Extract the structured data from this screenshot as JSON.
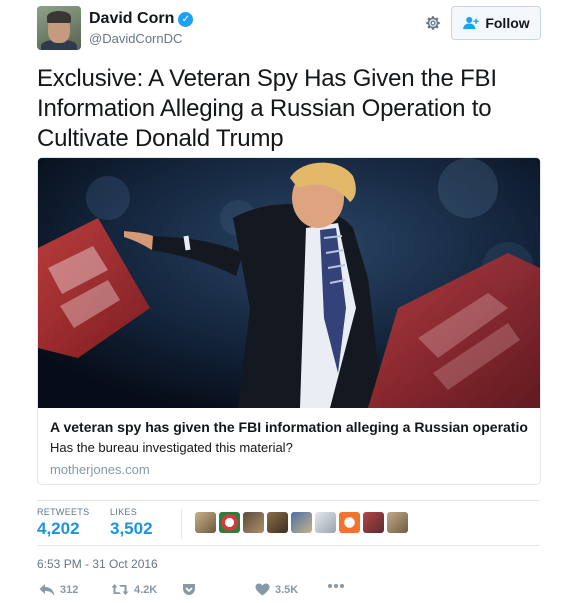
{
  "user": {
    "display_name": "David Corn",
    "handle": "@DavidCornDC"
  },
  "follow_button": {
    "label": "Follow"
  },
  "tweet": {
    "text": "Exclusive: A Veteran Spy Has Given the FBI Information Alleging a Russian Operation to Cultivate Donald Trump"
  },
  "card": {
    "title": "A veteran spy has given the FBI information alleging a Russian operation to c...",
    "description": "Has the bureau investigated this material?",
    "domain": "motherjones.com"
  },
  "stats": {
    "retweets_label": "RETWEETS",
    "retweets_value": "4,202",
    "likes_label": "LIKES",
    "likes_value": "3,502"
  },
  "timestamp": "6:53 PM - 31 Oct 2016",
  "actions": {
    "reply_count": "312",
    "retweet_count": "4.2K",
    "like_count": "3.5K"
  },
  "colors": {
    "link_blue": "#1b95e0",
    "verified_blue": "#1da1f2",
    "muted": "#8899a6"
  }
}
